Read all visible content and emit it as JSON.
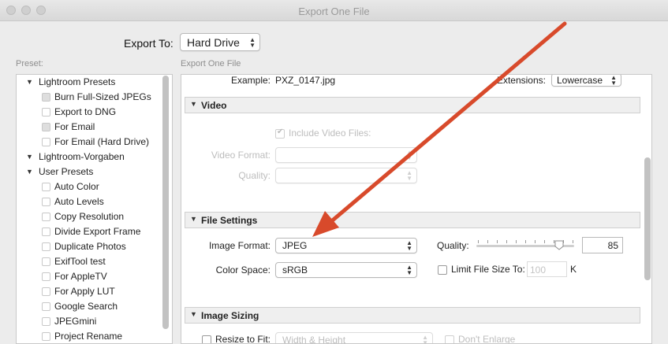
{
  "window": {
    "title": "Export One File"
  },
  "export_to": {
    "label": "Export To:",
    "value": "Hard Drive"
  },
  "preset": {
    "caption": "Preset:",
    "tree": [
      {
        "type": "folder",
        "label": "Lightroom Presets"
      },
      {
        "type": "item",
        "label": "Burn Full-Sized JPEGs",
        "grey": true
      },
      {
        "type": "item",
        "label": "Export to DNG",
        "grey": false
      },
      {
        "type": "item",
        "label": "For Email",
        "grey": true
      },
      {
        "type": "item",
        "label": "For Email (Hard Drive)",
        "grey": false
      },
      {
        "type": "folder",
        "label": "Lightroom-Vorgaben"
      },
      {
        "type": "folder",
        "label": "User Presets"
      },
      {
        "type": "item",
        "label": "Auto Color",
        "grey": false
      },
      {
        "type": "item",
        "label": "Auto Levels",
        "grey": false
      },
      {
        "type": "item",
        "label": "Copy Resolution",
        "grey": false
      },
      {
        "type": "item",
        "label": "Divide Export Frame",
        "grey": false
      },
      {
        "type": "item",
        "label": "Duplicate Photos",
        "grey": false
      },
      {
        "type": "item",
        "label": "ExifTool test",
        "grey": false
      },
      {
        "type": "item",
        "label": "For AppleTV",
        "grey": false
      },
      {
        "type": "item",
        "label": "For Apply LUT",
        "grey": false
      },
      {
        "type": "item",
        "label": "Google Search",
        "grey": false
      },
      {
        "type": "item",
        "label": "JPEGmini",
        "grey": false
      },
      {
        "type": "item",
        "label": "Project Rename",
        "grey": false
      }
    ]
  },
  "settings": {
    "caption": "Export One File",
    "example_label": "Example:",
    "example_value": "PXZ_0147.jpg",
    "extensions_label": "Extensions:",
    "extensions_value": "Lowercase",
    "video": {
      "header": "Video",
      "include_label": "Include Video Files:",
      "include_checked": true,
      "format_label": "Video Format:",
      "format_value": "",
      "quality_label": "Quality:",
      "quality_value": ""
    },
    "file_settings": {
      "header": "File Settings",
      "image_format_label": "Image Format:",
      "image_format_value": "JPEG",
      "quality_label": "Quality:",
      "quality_value": "85",
      "quality_level": 85,
      "color_space_label": "Color Space:",
      "color_space_value": "sRGB",
      "limit_label": "Limit File Size To:",
      "limit_checked": false,
      "limit_value": "100",
      "limit_unit": "K"
    },
    "image_sizing": {
      "header": "Image Sizing",
      "resize_label": "Resize to Fit:",
      "resize_checked": false,
      "resize_value": "Width & Height",
      "dont_enlarge_label": "Don't Enlarge"
    }
  },
  "annotation": {
    "arrow_color": "#d84a2b"
  },
  "colors": {
    "panel_bg": "#ffffff",
    "window_bg": "#ececec"
  }
}
